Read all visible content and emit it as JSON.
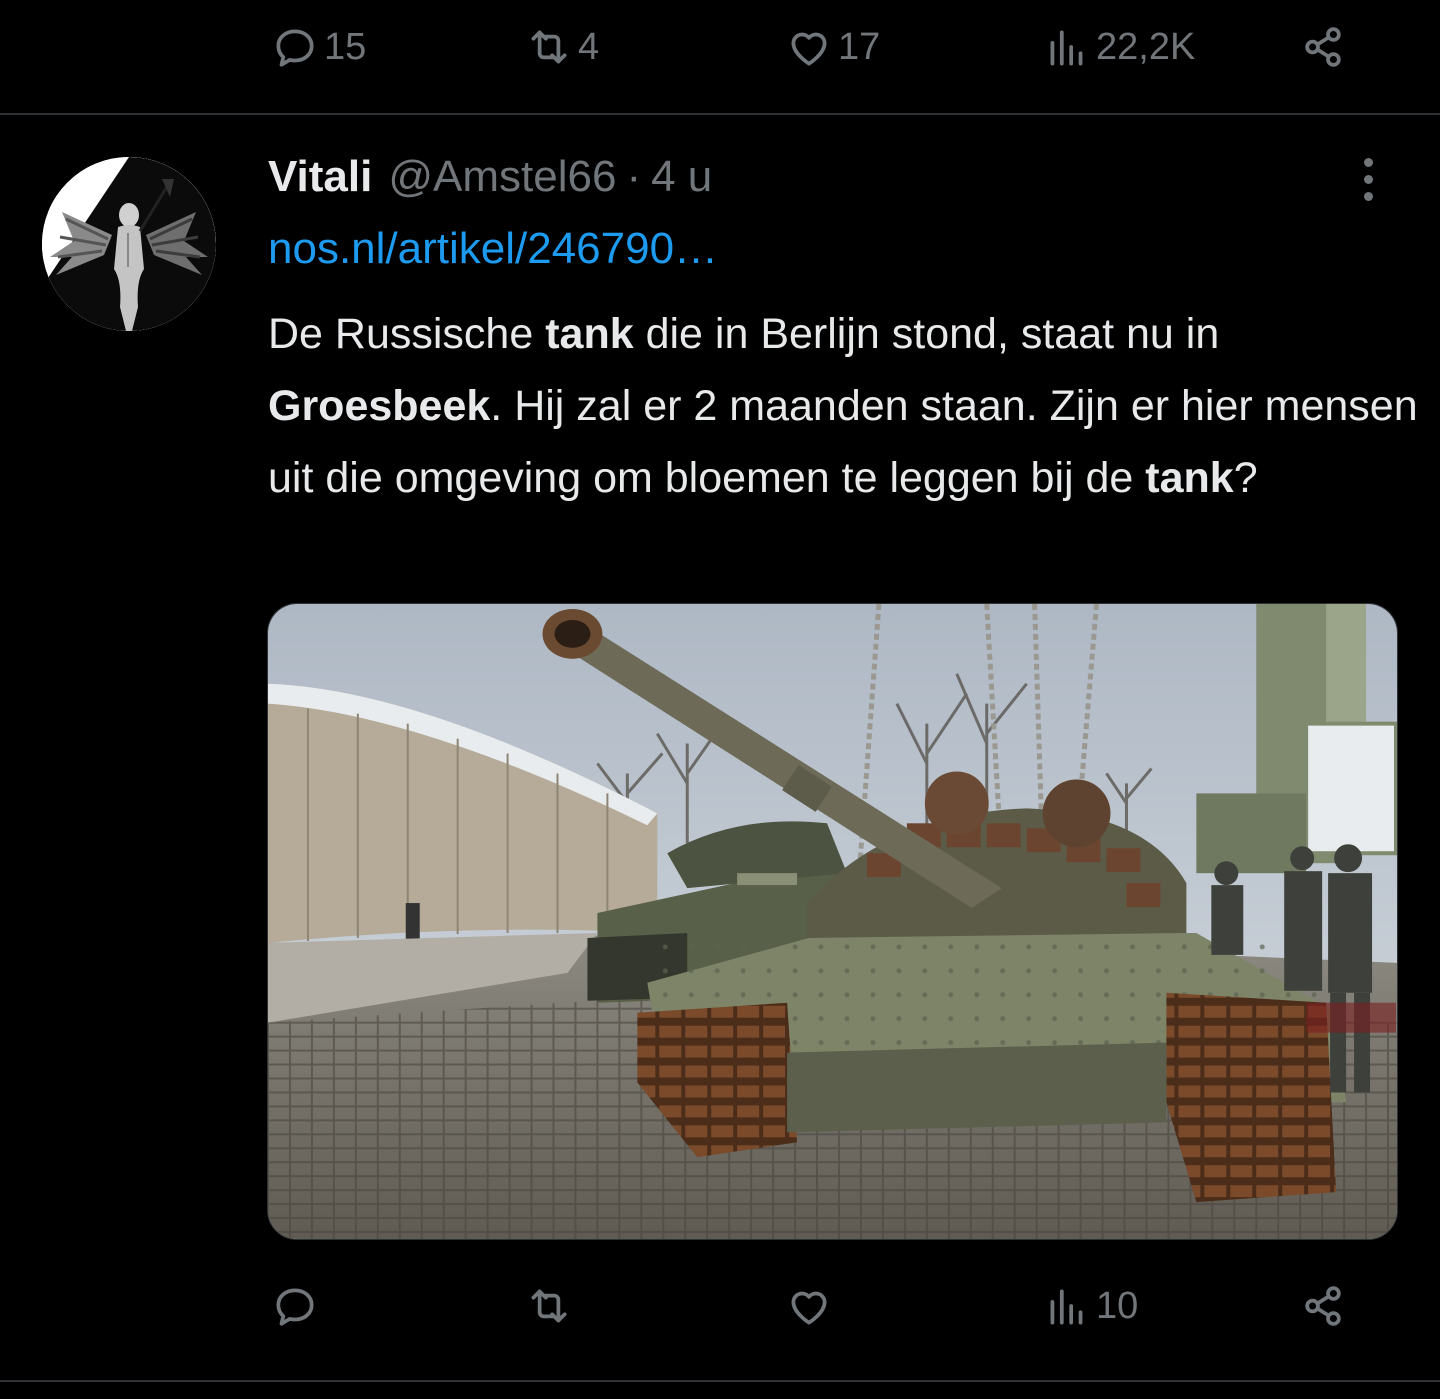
{
  "previous_tweet": {
    "actions": {
      "reply_count": "15",
      "retweet_count": "4",
      "like_count": "17",
      "views_count": "22,2K"
    }
  },
  "tweet": {
    "display_name": "Vitali",
    "handle": "@Amstel66",
    "separator": "·",
    "time": "4 u",
    "link_text": "nos.nl/artikel/246790…",
    "text": {
      "p1": "De Russische ",
      "b1": "tank",
      "p2": " die in Berlijn stond, staat nu in ",
      "b2": "Groesbeek",
      "p3": ". Hij zal er 2 maanden staan. Zijn er hier mensen uit die omgeving om bloemen te leggen bij de ",
      "b3": "tank",
      "p4": "?"
    },
    "actions": {
      "reply_count": "",
      "retweet_count": "",
      "like_count": "",
      "views_count": "10"
    }
  },
  "icons": {
    "reply": "speech-bubble-icon",
    "retweet": "retweet-arrows-icon",
    "like": "heart-icon",
    "views": "bar-chart-icon",
    "share": "share-nodes-icon",
    "more": "vertical-ellipsis-icon"
  },
  "colors": {
    "background": "#000000",
    "text": "#e7e9ea",
    "muted": "#71767b",
    "link": "#1d9bf0",
    "divider": "#2f3336"
  }
}
